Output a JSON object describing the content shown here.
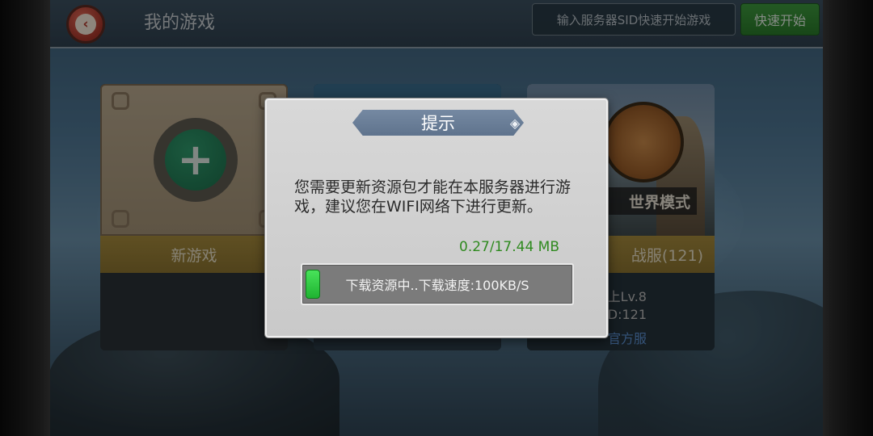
{
  "header": {
    "title": "我的游戏",
    "sid_placeholder": "输入服务器SID快速开始游戏",
    "quick_start_label": "快速开始"
  },
  "cards": {
    "new_game": {
      "label": "新游戏"
    },
    "server": {
      "mode_label": "世界模式",
      "name_label": "战服(121)",
      "level": "上Lv.8",
      "sid": "D:121",
      "official": "官方服"
    }
  },
  "dialog": {
    "title": "提示",
    "message": "您需要更新资源包才能在本服务器进行游戏，建议您在WIFI网络下进行更新。",
    "size_text": "0.27/17.44 MB",
    "progress_text": "下载资源中..下载速度:100KB/S",
    "progress_fraction": 0.0155
  },
  "colors": {
    "progress_green": "#1fb331",
    "size_text": "#2f8a1f",
    "quick_start": "#2a7a2a",
    "back_button": "#a8362a"
  },
  "icons": {
    "back": "back-arrow-icon",
    "plus": "plus-icon",
    "title_ornament": "ornament-icon"
  }
}
